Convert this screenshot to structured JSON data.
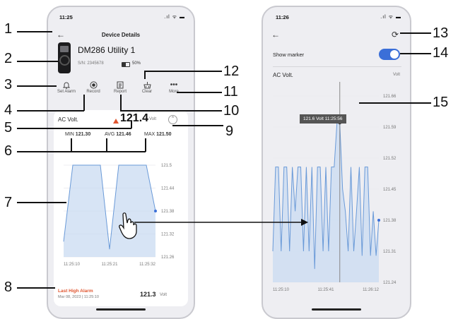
{
  "left_phone": {
    "status_time": "11:25",
    "status_icons": ".ıl ᯤ ▬",
    "title": "Device Details",
    "device_name": "DM286 Utility 1",
    "serial": "S/N: 2345678",
    "battery": "50%",
    "actions": [
      {
        "label": "Set Alarm",
        "icon": "bell-icon"
      },
      {
        "label": "Record",
        "icon": "record-icon"
      },
      {
        "label": "Report",
        "icon": "report-icon"
      },
      {
        "label": "Clear",
        "icon": "clear-icon"
      },
      {
        "label": "More",
        "icon": "more-icon"
      }
    ],
    "reading_label": "AC Volt.",
    "reading_value": "121.4",
    "reading_unit": "Volt",
    "min_label": "MIN",
    "min_value": "121.30",
    "avg_label": "AVG",
    "avg_value": "121.46",
    "max_label": "MAX",
    "max_value": "121.50",
    "alarm_title": "Last High Alarm",
    "alarm_date": "Mar 08, 2023 | 11:25:10",
    "alarm_value": "121.3",
    "alarm_unit": "Volt",
    "chart_data": {
      "type": "area",
      "x_ticks": [
        "11:25:10",
        "11:25:21",
        "11:25:32"
      ],
      "y_ticks": [
        "121.5",
        "121.44",
        "121.38",
        "121.32",
        "121.26"
      ],
      "ylim": [
        121.26,
        121.5
      ],
      "values": [
        121.3,
        121.5,
        121.5,
        121.5,
        121.5,
        121.28,
        121.5,
        121.5,
        121.5,
        121.5,
        121.38
      ]
    }
  },
  "right_phone": {
    "status_time": "11:26",
    "status_icons": ".ıl ᯤ ▬",
    "toggle_label": "Show marker",
    "toggle_on": true,
    "reading_label": "AC Volt.",
    "unit_label": "Volt",
    "tooltip": "121.6 Volt 11:25:56",
    "chart_data": {
      "type": "area",
      "x_ticks": [
        "11:25:10",
        "11:25:41",
        "11:26:12"
      ],
      "y_ticks": [
        "121.66",
        "121.59",
        "121.52",
        "121.45",
        "121.38",
        "121.31",
        "121.24"
      ],
      "ylim": [
        121.24,
        121.66
      ],
      "values": [
        121.31,
        121.5,
        121.5,
        121.31,
        121.5,
        121.5,
        121.31,
        121.5,
        121.4,
        121.5,
        121.5,
        121.31,
        121.5,
        121.31,
        121.5,
        121.27,
        121.5,
        121.5,
        121.31,
        121.5,
        121.31,
        121.5,
        121.5,
        121.6,
        121.6,
        121.45,
        121.4,
        121.31,
        121.5,
        121.31,
        121.4,
        121.5,
        121.3,
        121.5,
        121.5,
        121.3,
        121.4,
        121.3,
        121.38
      ]
    }
  },
  "callouts": [
    "1",
    "2",
    "3",
    "4",
    "5",
    "6",
    "7",
    "8",
    "9",
    "10",
    "11",
    "12",
    "13",
    "14",
    "15"
  ],
  "colors": {
    "accent": "#3b6fd8",
    "alarm": "#e0552f",
    "area_fill": "#c9dbf2",
    "area_stroke": "#6a9ad8"
  }
}
